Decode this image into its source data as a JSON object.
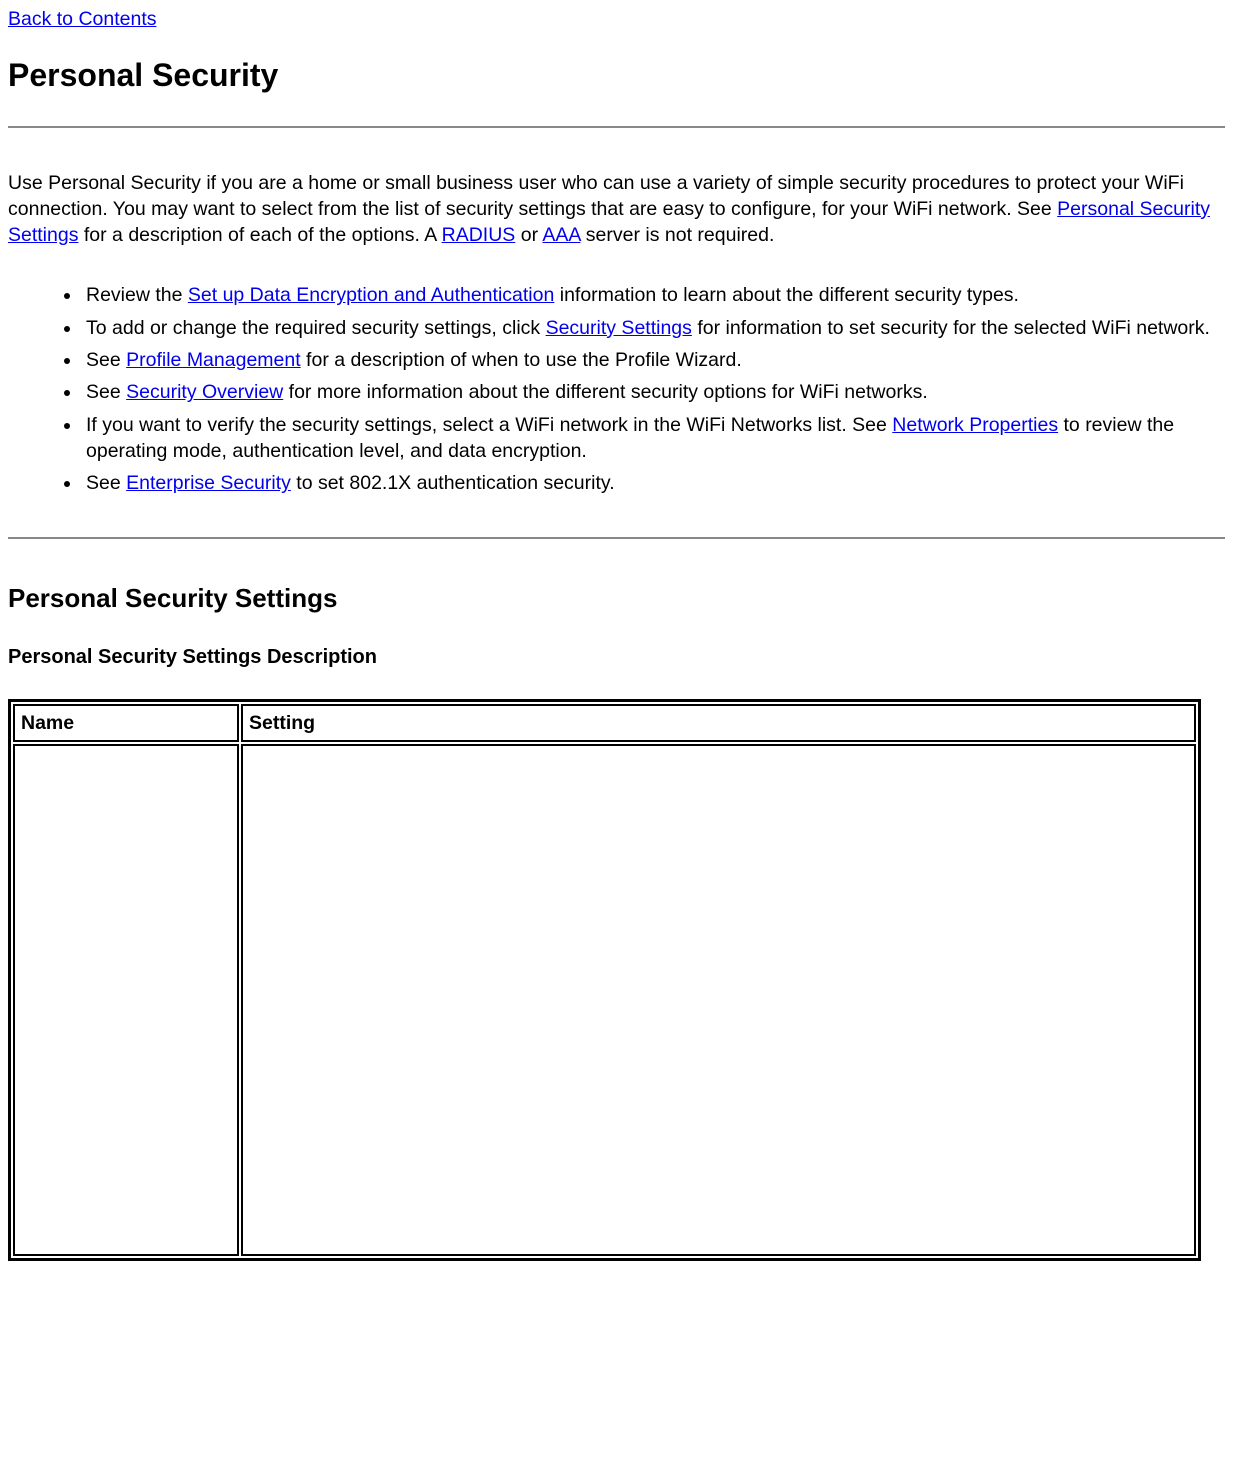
{
  "nav": {
    "back_link": "Back to Contents"
  },
  "heading": "Personal Security",
  "intro": {
    "pre": "Use Personal Security if you are a home or small business user who can use a variety of simple security procedures to protect your WiFi connection. You may want to select from the list of security settings that are easy to configure, for your WiFi network. See ",
    "link1": "Personal Security Settings",
    "mid1": " for a description of each of the options. A ",
    "link2": "RADIUS",
    "mid2": " or ",
    "link3": "AAA",
    "post": " server is not required."
  },
  "bullets": [
    {
      "pre": "Review the ",
      "link": "Set up Data Encryption and Authentication",
      "post": " information to learn about the different security types."
    },
    {
      "pre": "To add or change the required security settings, click ",
      "link": "Security Settings",
      "post": " for information to set security for the selected WiFi network."
    },
    {
      "pre": "See ",
      "link": "Profile Management",
      "post": " for a description of when to use the Profile Wizard."
    },
    {
      "pre": "See ",
      "link": "Security Overview",
      "post": " for more information about the different security options for WiFi networks."
    },
    {
      "pre": "If you want to verify the security settings, select a WiFi network in the WiFi Networks list. See ",
      "link": "Network Properties",
      "post": " to review the operating mode, authentication level, and data encryption."
    },
    {
      "pre": "See ",
      "link": "Enterprise Security",
      "post": " to set 802.1X authentication security."
    }
  ],
  "section2": {
    "heading": "Personal Security Settings",
    "subheading": "Personal Security Settings Description",
    "table": {
      "col1": "Name",
      "col2": "Setting"
    }
  }
}
